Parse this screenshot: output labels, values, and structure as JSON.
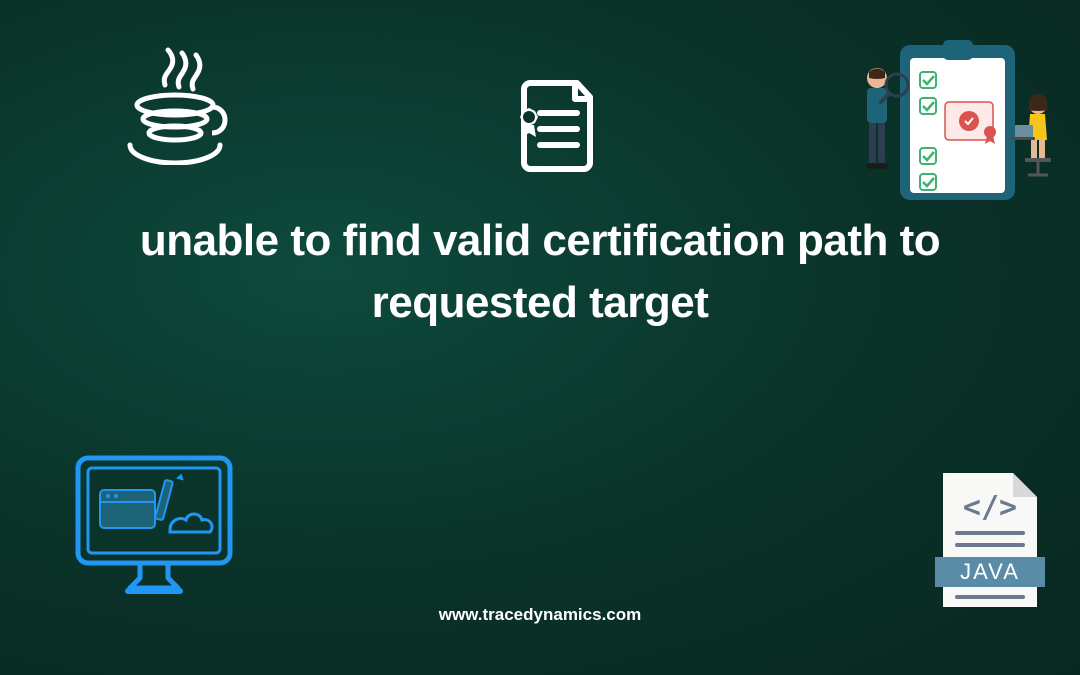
{
  "heading": "unable to find valid certification path to requested target",
  "website_url": "www.tracedynamics.com",
  "java_file_label": "JAVA"
}
